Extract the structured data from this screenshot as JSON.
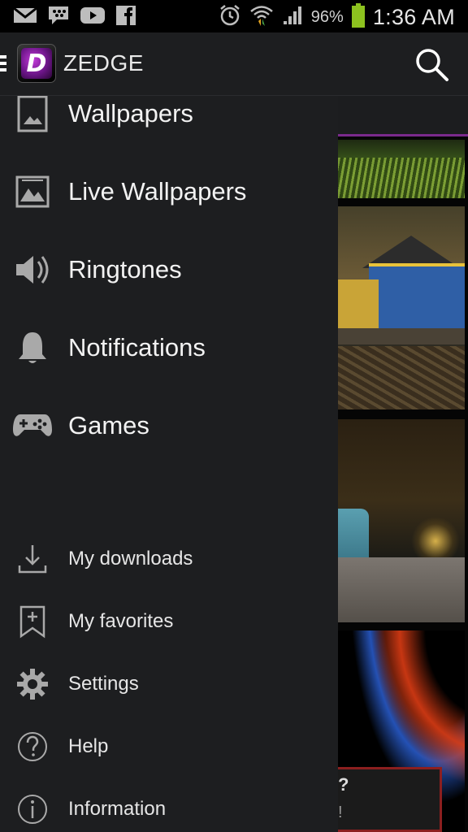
{
  "status_bar": {
    "left_icons": [
      "gmail-icon",
      "bbm-icon",
      "youtube-icon",
      "facebook-icon"
    ],
    "right_icons": [
      "alarm-icon",
      "wifi-icon",
      "signal-icon",
      "battery-icon"
    ],
    "battery_percent": "96%",
    "battery_level": 0.96,
    "time": "1:36 AM"
  },
  "app_bar": {
    "logo_letter": "D",
    "title": "ZEDGE",
    "search_icon": "search-icon",
    "menu_icon": "hamburger-icon"
  },
  "drawer": {
    "primary": [
      {
        "label": "Wallpapers",
        "icon": "wallpaper-icon"
      },
      {
        "label": "Live Wallpapers",
        "icon": "live-wallpaper-icon"
      },
      {
        "label": "Ringtones",
        "icon": "speaker-icon"
      },
      {
        "label": "Notifications",
        "icon": "bell-icon"
      },
      {
        "label": "Games",
        "icon": "gamepad-icon"
      }
    ],
    "secondary": [
      {
        "label": "My downloads",
        "icon": "download-icon"
      },
      {
        "label": "My favorites",
        "icon": "bookmark-add-icon"
      },
      {
        "label": "Settings",
        "icon": "gear-icon"
      },
      {
        "label": "Help",
        "icon": "help-icon"
      },
      {
        "label": "Information",
        "icon": "info-icon"
      }
    ]
  },
  "background": {
    "dialog_fragment": {
      "line1": "?",
      "line2": "!"
    }
  },
  "colors": {
    "drawer_bg": "#1d1e20",
    "accent_purple": "#7a2a8c",
    "battery_green": "#8dc21f",
    "icon_gray": "#a9a9a9"
  }
}
